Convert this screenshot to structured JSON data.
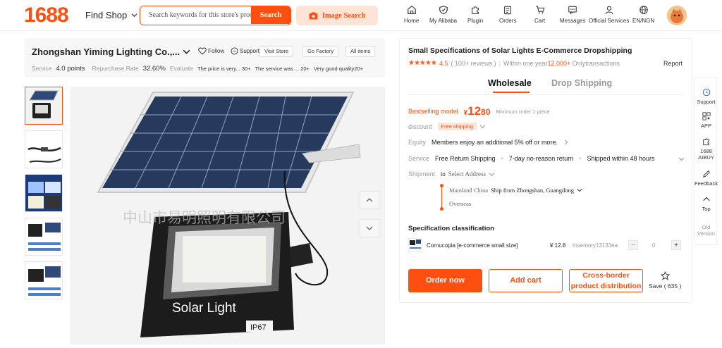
{
  "header": {
    "logo": "1688",
    "find_shop": "Find Shop",
    "search_placeholder": "Search keywords for this store's products",
    "search_button": "Search",
    "image_search": "Image Search",
    "nav": [
      {
        "label": "Home",
        "icon": "home-icon"
      },
      {
        "label": "My Alibaba",
        "icon": "shield-icon"
      },
      {
        "label": "Plugin",
        "icon": "puzzle-icon"
      },
      {
        "label": "Orders",
        "icon": "clipboard-icon"
      },
      {
        "label": "Cart",
        "icon": "cart-icon"
      },
      {
        "label": "Messages",
        "icon": "chat-icon"
      },
      {
        "label": "Official Services",
        "icon": "user-icon"
      },
      {
        "label": "EN/NGN",
        "icon": "globe-icon"
      }
    ]
  },
  "shop": {
    "name": "Zhongshan Yiming Lighting Co.,...",
    "follow": "Follow",
    "support": "Support",
    "buttons": [
      "Visit Store",
      "Go Factory",
      "All items"
    ],
    "service_label": "Service",
    "service_value": "4.0 points",
    "repurchase_label": "Repurchase Rate",
    "repurchase_value": "32.60%",
    "evaluate_label": "Evaluate",
    "tags": [
      "The price is very...  30+",
      "The service was ...  20+",
      "Very good quality20+"
    ]
  },
  "gallery": {
    "watermark": "中山市易明照明有限公司",
    "panel_text": "Solar Light",
    "ip_text": "IP67"
  },
  "product": {
    "title": "Small Specifications of Solar Lights E-Commerce Dropshipping",
    "rating": "4.5",
    "reviews": "( 100+ reviews )",
    "transactions_prefix": "Within one year",
    "transactions_count": "12,000+",
    "transactions_suffix": " Onlytransactions",
    "report": "Report",
    "tab_wholesale": "Wholesale",
    "tab_dropship": "Drop Shipping",
    "bestselling_label": "Bestselling model",
    "price_symbol": "¥",
    "price_int": "12",
    "price_dec": "80",
    "min_order": "Minimum order 1 piece",
    "discount_label": "discount",
    "free_shipping": "Free shipping",
    "equity_label": "Equity",
    "equity_text": "Members enjoy an additional 5% off or more.",
    "service_label": "Service",
    "services": [
      "Free Return Shipping",
      "7-day no-reason return",
      "Shipped within 48 hours"
    ],
    "shipment_label": "Shipment",
    "ship_to": "to",
    "select_address": "Select Address",
    "origin_region": "Mainland China",
    "origin_text": "Ship from Zhongshan, Guangdong",
    "overseas": "Overseas",
    "spec_title": "Specification classification",
    "spec_name": "Cornucopia [e-commerce small size]",
    "spec_price": "¥ 12.8",
    "spec_inventory": "Inventory13133ea",
    "qty": "0",
    "order_now": "Order now",
    "add_cart": "Add cart",
    "cross_border": "Cross-border product distribution",
    "save_label": "Save ( 635 )"
  },
  "sidebar": {
    "support": "Support",
    "app": "APP",
    "aibuy": "1688 AIBUY",
    "feedback": "Feedback",
    "top": "Top",
    "old_version": "Old Version"
  },
  "colors": {
    "accent": "#ff4f10",
    "accent_light": "#fde4d6"
  }
}
